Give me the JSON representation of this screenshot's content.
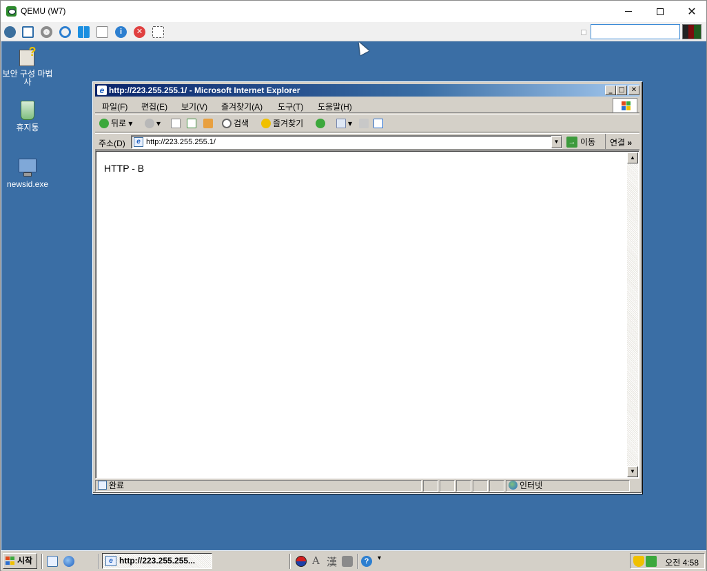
{
  "host": {
    "title": "QEMU (W7)",
    "window_controls": {
      "minimize": "minimize",
      "maximize": "maximize",
      "close": "✕"
    },
    "toolbar_icons": [
      "cube-icon",
      "fullscreen-icon",
      "settings-gear-icon",
      "refresh-icon",
      "windows-logo-icon",
      "keyboard-icon",
      "info-icon",
      "stop-icon",
      "screenshot-icon"
    ],
    "search_value": "",
    "accent_color": "#3a8ad6"
  },
  "desktop": {
    "background_color": "#3a6ea5",
    "icons": [
      {
        "label": "보안 구성 마법사",
        "icon": "security-wizard-icon"
      },
      {
        "label": "휴지통",
        "icon": "recycle-bin-icon"
      },
      {
        "label": "newsid.exe",
        "icon": "newsid-exe-icon"
      }
    ]
  },
  "ie": {
    "title": "http://223.255.255.1/ - Microsoft Internet Explorer",
    "caption_buttons": {
      "minimize": "_",
      "maximize": "□",
      "close": "✕"
    },
    "menu": [
      "파일(F)",
      "편집(E)",
      "보기(V)",
      "즐겨찾기(A)",
      "도구(T)",
      "도움말(H)"
    ],
    "toolbar": {
      "back": "뒤로",
      "search": "검색",
      "favorites": "즐겨찾기"
    },
    "address": {
      "label": "주소(D)",
      "url": "http://223.255.255.1/",
      "go": "이동",
      "links": "연결",
      "chevron": "»"
    },
    "page": {
      "text": "HTTP - B"
    },
    "status": {
      "text": "완료",
      "zone": "인터넷"
    }
  },
  "taskbar": {
    "start": "시작",
    "task_button": "http://223.255.255...",
    "ime": {
      "mode": "A",
      "hanja": "漢"
    },
    "clock": "오전 4:58"
  }
}
